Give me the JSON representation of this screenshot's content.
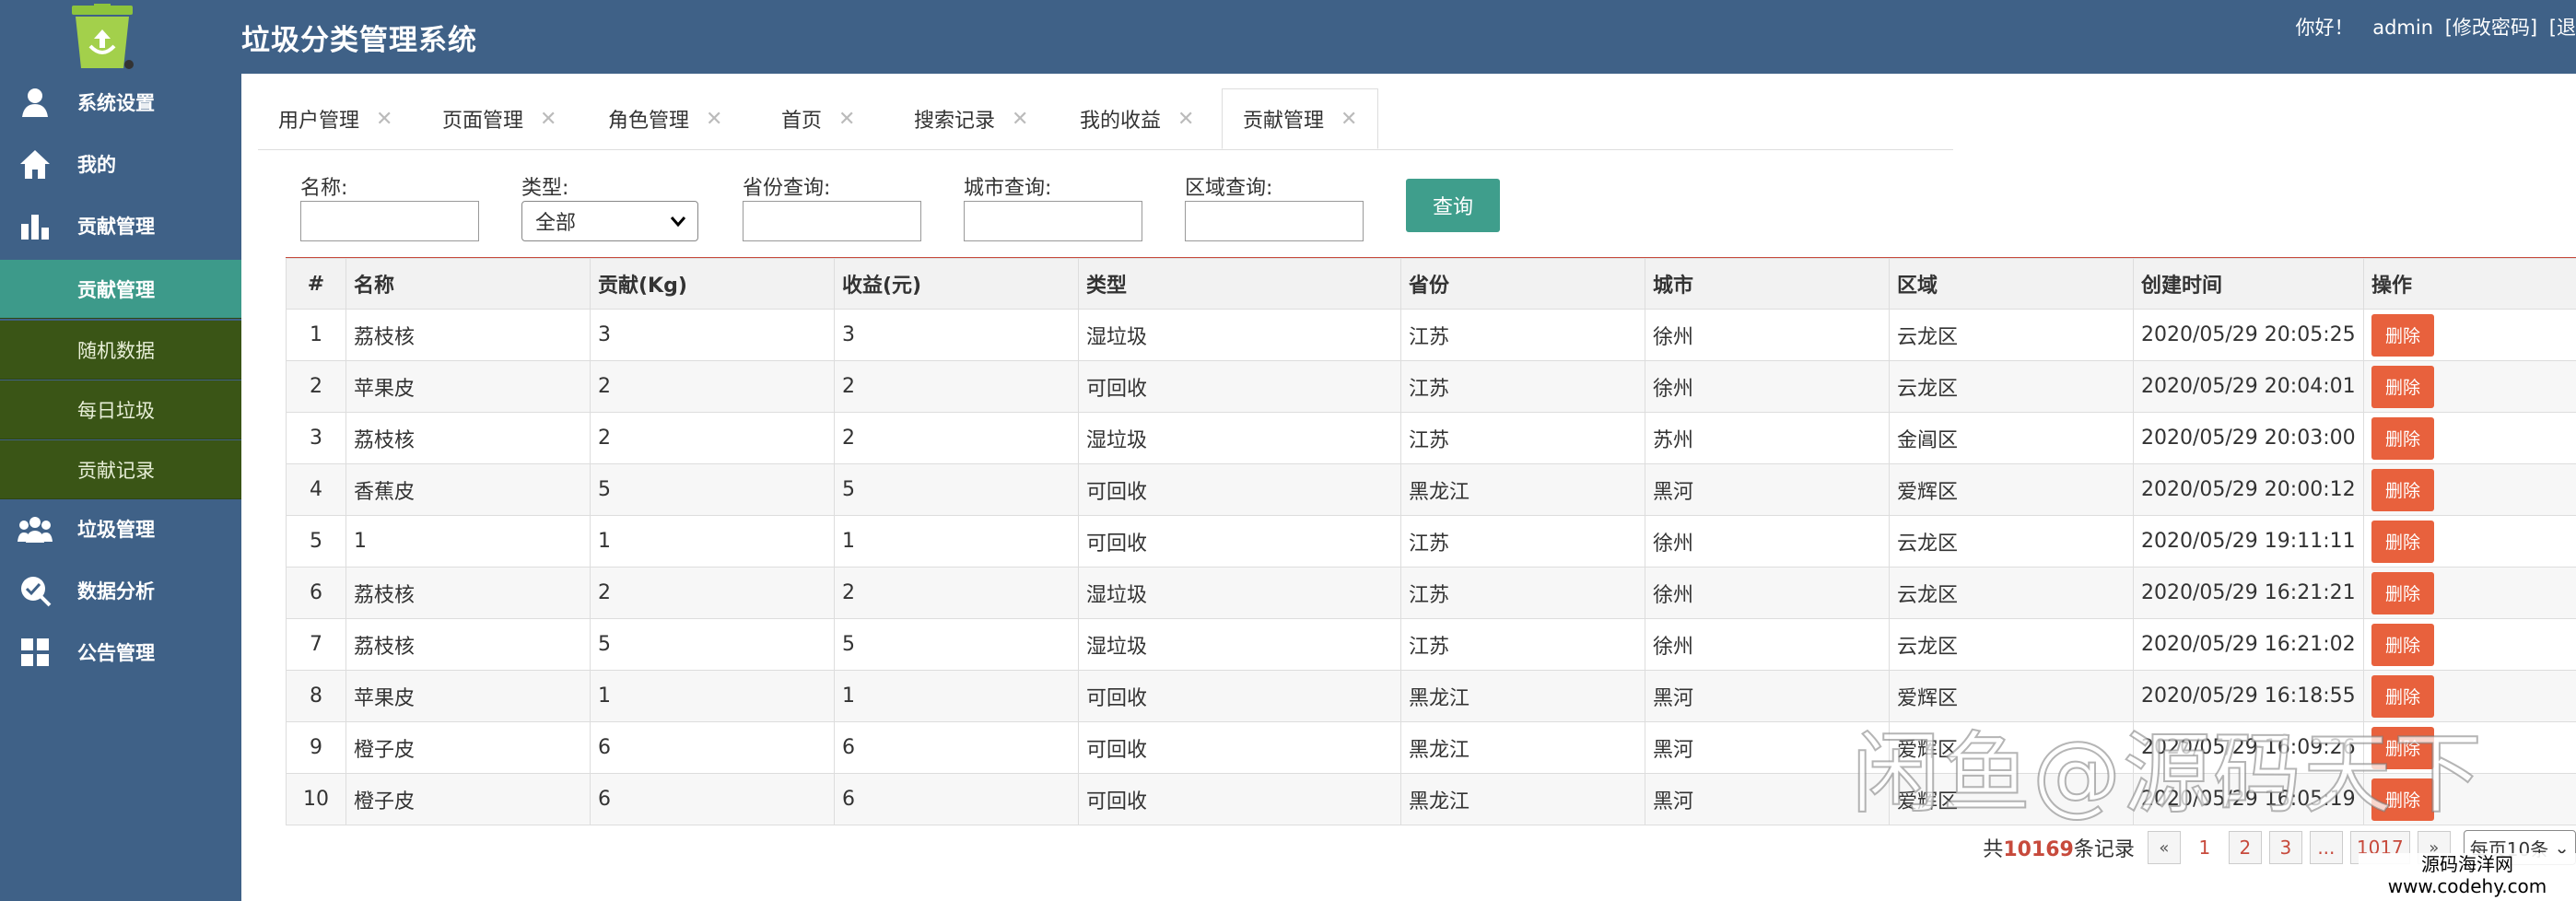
{
  "header": {
    "title": "垃圾分类管理系统",
    "greeting": "你好！",
    "username": "admin",
    "change_password": "[修改密码]",
    "logout": "[退"
  },
  "sidebar": {
    "items": [
      {
        "label": "系统设置",
        "icon": "user-icon"
      },
      {
        "label": "我的",
        "icon": "home-icon"
      },
      {
        "label": "贡献管理",
        "icon": "bar-chart-icon"
      }
    ],
    "sub_items": [
      {
        "label": "贡献管理",
        "active": true
      },
      {
        "label": "随机数据",
        "active": false
      },
      {
        "label": "每日垃圾",
        "active": false
      },
      {
        "label": "贡献记录",
        "active": false
      }
    ],
    "items_after": [
      {
        "label": "垃圾管理",
        "icon": "group-icon"
      },
      {
        "label": "数据分析",
        "icon": "badge-icon"
      },
      {
        "label": "公告管理",
        "icon": "grid-icon"
      }
    ]
  },
  "tabs": [
    {
      "label": "用户管理"
    },
    {
      "label": "页面管理"
    },
    {
      "label": "角色管理"
    },
    {
      "label": "首页"
    },
    {
      "label": "搜索记录"
    },
    {
      "label": "我的收益"
    },
    {
      "label": "贡献管理",
      "active": true
    }
  ],
  "filters": {
    "name_label": "名称:",
    "type_label": "类型:",
    "type_value": "全部",
    "province_label": "省份查询:",
    "city_label": "城市查询:",
    "district_label": "区域查询:",
    "query_button": "查询"
  },
  "table": {
    "columns": [
      "#",
      "名称",
      "贡献(Kg)",
      "收益(元)",
      "类型",
      "省份",
      "城市",
      "区域",
      "创建时间",
      "操作"
    ],
    "delete_label": "删除",
    "rows": [
      [
        "1",
        "荔枝核",
        "3",
        "3",
        "湿垃圾",
        "江苏",
        "徐州",
        "云龙区",
        "2020/05/29 20:05:25"
      ],
      [
        "2",
        "苹果皮",
        "2",
        "2",
        "可回收",
        "江苏",
        "徐州",
        "云龙区",
        "2020/05/29 20:04:01"
      ],
      [
        "3",
        "荔枝核",
        "2",
        "2",
        "湿垃圾",
        "江苏",
        "苏州",
        "金阊区",
        "2020/05/29 20:03:00"
      ],
      [
        "4",
        "香蕉皮",
        "5",
        "5",
        "可回收",
        "黑龙江",
        "黑河",
        "爱辉区",
        "2020/05/29 20:00:12"
      ],
      [
        "5",
        "1",
        "1",
        "1",
        "可回收",
        "江苏",
        "徐州",
        "云龙区",
        "2020/05/29 19:11:11"
      ],
      [
        "6",
        "荔枝核",
        "2",
        "2",
        "湿垃圾",
        "江苏",
        "徐州",
        "云龙区",
        "2020/05/29 16:21:21"
      ],
      [
        "7",
        "荔枝核",
        "5",
        "5",
        "湿垃圾",
        "江苏",
        "徐州",
        "云龙区",
        "2020/05/29 16:21:02"
      ],
      [
        "8",
        "苹果皮",
        "1",
        "1",
        "可回收",
        "黑龙江",
        "黑河",
        "爱辉区",
        "2020/05/29 16:18:55"
      ],
      [
        "9",
        "橙子皮",
        "6",
        "6",
        "可回收",
        "黑龙江",
        "黑河",
        "爱辉区",
        "2020/05/29 16:09:26"
      ],
      [
        "10",
        "橙子皮",
        "6",
        "6",
        "可回收",
        "黑龙江",
        "黑河",
        "爱辉区",
        "2020/05/29 16:05:19"
      ]
    ]
  },
  "pagination": {
    "total_prefix": "共",
    "total_count": "10169",
    "total_suffix": "条记录",
    "prev": "«",
    "pages": [
      "1",
      "2",
      "3",
      "...",
      "1017"
    ],
    "next": "»",
    "per_page": "每页10条"
  },
  "overlays": {
    "watermark": "闲鱼@源码天下",
    "site_name": "源码海洋网",
    "site_url": "www.codehy.com"
  },
  "colors": {
    "header_bg": "#3f6187",
    "submenu_bg": "#3a5516",
    "active_submenu": "#3d9a8a",
    "query_button": "#3f9e8c",
    "delete_button": "#e8613d",
    "accent_red": "#c74a3c"
  }
}
